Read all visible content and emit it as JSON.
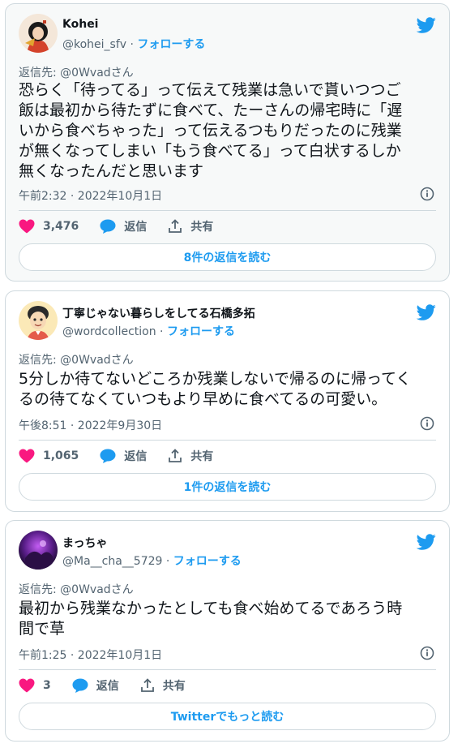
{
  "tweets": [
    {
      "display_name": "Kohei",
      "handle": "@kohei_sfv",
      "separator": "·",
      "follow_label": "フォローする",
      "reply_to_label": "返信先: ",
      "reply_to_user": "@0Wvadさん",
      "text": "恐らく「待ってる」って伝えて残業は急いで貰いつつご\n飯は最初から待たずに食べて、たーさんの帰宅時に「遅\nいから食べちゃった」って伝えるつもりだったのに残業\nが無くなってしまい「もう食べてる」って白状するしか\n無くなったんだと思います",
      "timestamp": "午前2:32 · 2022年10月1日",
      "likes": "3,476",
      "reply_label": "返信",
      "share_label": "共有",
      "replies_button": "8件の返信を読む"
    },
    {
      "display_name": "丁寧じゃない暮らしをしてる石橋多拓",
      "handle": "@wordcollection",
      "separator": "·",
      "follow_label": "フォローする",
      "reply_to_label": "返信先: ",
      "reply_to_user": "@0Wvadさん",
      "text": "5分しか待てないどころか残業しないで帰るのに帰ってく\nるの待てなくていつもより早めに食べてるの可愛い。",
      "timestamp": "午後8:51 · 2022年9月30日",
      "likes": "1,065",
      "reply_label": "返信",
      "share_label": "共有",
      "replies_button": "1件の返信を読む"
    },
    {
      "display_name": "まっちゃ",
      "handle": "@Ma__cha__5729",
      "separator": "·",
      "follow_label": "フォローする",
      "reply_to_label": "返信先: ",
      "reply_to_user": "@0Wvadさん",
      "text": "最初から残業なかったとしても食べ始めてるであろう時\n間で草",
      "timestamp": "午前1:25 · 2022年10月1日",
      "likes": "3",
      "reply_label": "返信",
      "share_label": "共有",
      "replies_button": "Twitterでもっと読む"
    }
  ],
  "icons": {
    "brand": "twitter-bird-icon",
    "like": "heart-icon",
    "reply": "speech-bubble-icon",
    "share": "share-icon",
    "info": "info-icon"
  },
  "colors": {
    "accent": "#1d9bf0",
    "like": "#f91880",
    "muted": "#536471",
    "border": "#cfd9de"
  }
}
